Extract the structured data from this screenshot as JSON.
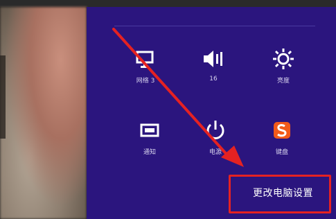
{
  "charms": {
    "quick_settings": [
      {
        "label": "网络 3",
        "icon": "network-icon"
      },
      {
        "label": "16",
        "icon": "volume-icon"
      },
      {
        "label": "亮度",
        "icon": "brightness-icon"
      },
      {
        "label": "通知",
        "icon": "notifications-icon"
      },
      {
        "label": "电源",
        "icon": "power-icon"
      },
      {
        "label": "键盘",
        "icon": "keyboard-ime-icon"
      }
    ],
    "change_pc_settings": "更改电脑设置"
  },
  "colors": {
    "charm_background": "#2b157e",
    "annotation": "#e52222"
  }
}
